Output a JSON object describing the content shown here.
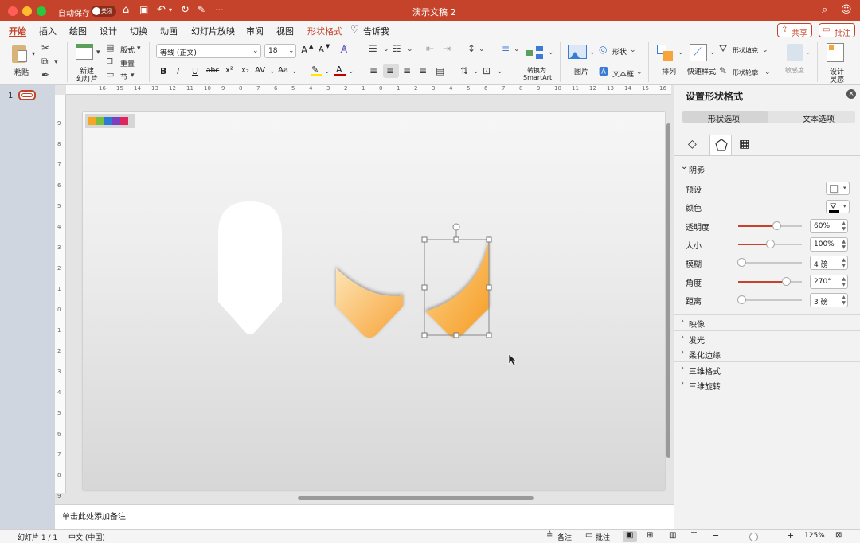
{
  "window": {
    "autosave_label": "自动保存",
    "toggle_label": "关闭",
    "title": "演示文稿 2",
    "more": "···"
  },
  "tabs": [
    "开始",
    "插入",
    "绘图",
    "设计",
    "切换",
    "动画",
    "幻灯片放映",
    "审阅",
    "视图",
    "形状格式"
  ],
  "tell_me": "告诉我",
  "share_button": "共享",
  "comments_button": "批注",
  "ribbon": {
    "paste": "粘贴",
    "new_slide_line1": "新建",
    "new_slide_line2": "幻灯片",
    "layout": "版式",
    "reset": "重置",
    "section": "节",
    "font_name": "等线 (正文)",
    "font_size": "18",
    "convert_smartart_line1": "转换为",
    "convert_smartart_line2": "SmartArt",
    "picture": "图片",
    "shapes": "形状",
    "textbox": "文本框",
    "arrange": "排列",
    "quick_styles": "快速样式",
    "shape_fill": "形状填充",
    "shape_outline": "形状轮廓",
    "sensitivity": "敏感度",
    "designer_line1": "设计",
    "designer_line2": "灵感",
    "bold": "B",
    "italic": "I",
    "underline": "U",
    "strike": "abc",
    "superscript": "x²",
    "subscript": "x₂",
    "spacing": "AV",
    "case": "Aa",
    "grow": "A",
    "shrink": "A"
  },
  "thumbnail_number": "1",
  "ruler_numbers": [
    "16",
    "15",
    "14",
    "13",
    "12",
    "11",
    "10",
    "9",
    "8",
    "7",
    "6",
    "5",
    "4",
    "3",
    "2",
    "1",
    "0",
    "1",
    "2",
    "3",
    "4",
    "5",
    "6",
    "7",
    "8",
    "9",
    "10",
    "11",
    "12",
    "13",
    "14",
    "15",
    "16"
  ],
  "vruler_numbers": [
    "9",
    "8",
    "7",
    "6",
    "5",
    "4",
    "3",
    "2",
    "1",
    "0",
    "1",
    "2",
    "3",
    "4",
    "5",
    "6",
    "7",
    "8",
    "9"
  ],
  "color_bar": [
    "#f5a623",
    "#7cbf3f",
    "#2b7bd6",
    "#7b3fc0",
    "#e0245e"
  ],
  "notes_placeholder": "单击此处添加备注",
  "pane": {
    "title": "设置形状格式",
    "tab_shape": "形状选项",
    "tab_text": "文本选项",
    "section_shadow": "阴影",
    "rows": [
      {
        "label": "预设"
      },
      {
        "label": "颜色"
      },
      {
        "label": "透明度",
        "value": "60%",
        "level": 0.6
      },
      {
        "label": "大小",
        "value": "100%",
        "level": 0.5
      },
      {
        "label": "模糊",
        "value": "4 磅",
        "level": 0.05
      },
      {
        "label": "角度",
        "value": "270°",
        "level": 0.75
      },
      {
        "label": "距离",
        "value": "3 磅",
        "level": 0.05
      }
    ],
    "collapsed_sections": [
      "映像",
      "发光",
      "柔化边缘",
      "三维格式",
      "三维旋转"
    ]
  },
  "status": {
    "slide_info": "幻灯片 1 / 1",
    "language": "中文 (中国)",
    "notes": "备注",
    "comments": "批注",
    "zoom": "125%"
  },
  "colors": {
    "accent": "#c5432a",
    "shape_orange": "#f7a43a",
    "shape_light": "#fdd28a"
  }
}
